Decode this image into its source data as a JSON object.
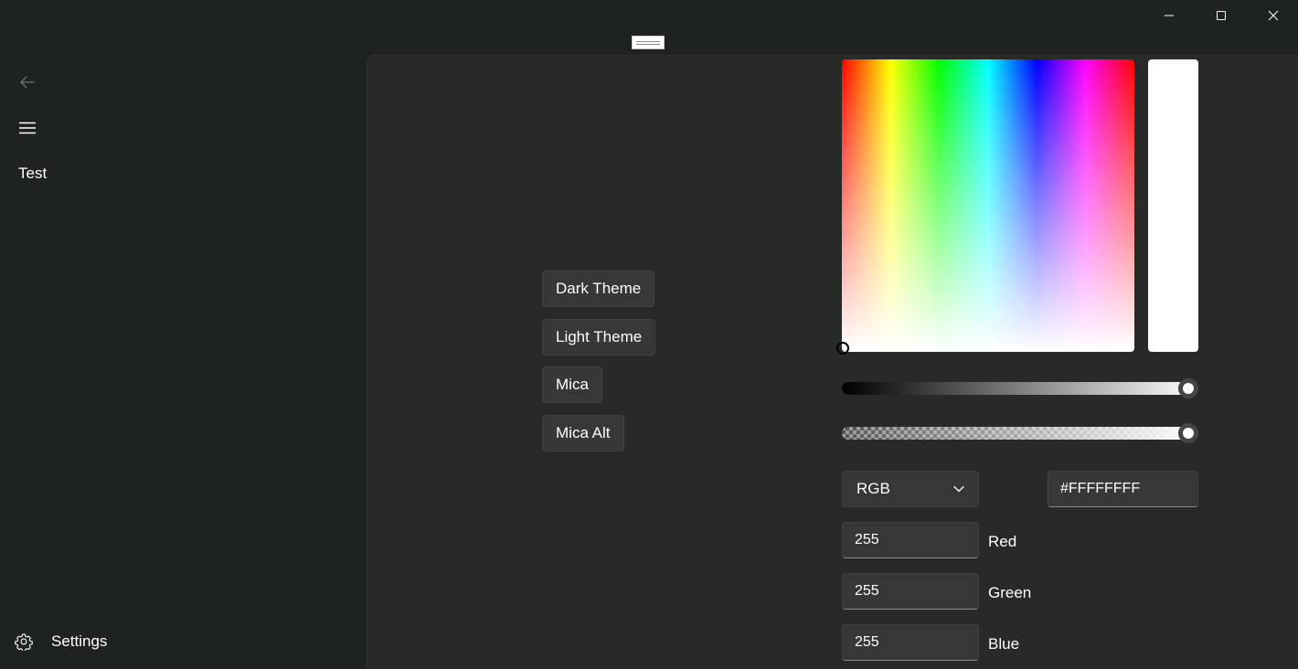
{
  "nav": {
    "items": [
      {
        "label": "Test"
      }
    ],
    "settings_label": "Settings"
  },
  "theme_buttons": [
    {
      "label": "Dark Theme"
    },
    {
      "label": "Light Theme"
    },
    {
      "label": "Mica"
    },
    {
      "label": "Mica Alt"
    }
  ],
  "color_picker": {
    "selected_color": "#FFFFFF",
    "value_slider": 1.0,
    "alpha_slider": 1.0,
    "mode": "RGB",
    "hex_value": "#FFFFFFFF",
    "channels": [
      {
        "label": "Red",
        "value": "255"
      },
      {
        "label": "Green",
        "value": "255"
      },
      {
        "label": "Blue",
        "value": "255"
      }
    ]
  },
  "colors": {
    "window_bg": "#1f2320",
    "content_bg": "#282a27",
    "control_bg": "#363835"
  }
}
